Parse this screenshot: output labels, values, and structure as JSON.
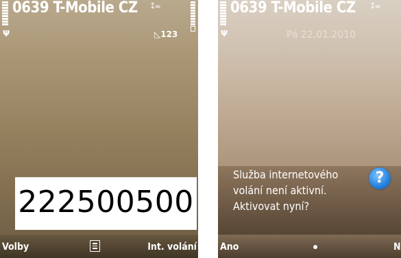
{
  "left_screen": {
    "operator": "0639 T-Mobile CZ",
    "bt_symbol": "⁑≈",
    "antenna_symbol": "Ψ",
    "message_indicator": "◺123",
    "dialed_number": "222500500",
    "soft_left": "Volby",
    "soft_right": "Int. volání"
  },
  "right_screen": {
    "operator": "0639 T-Mobile CZ",
    "bt_symbol": "⁑≈",
    "antenna_symbol": "Ψ",
    "date": "Pá 22.01.2010",
    "dialog": {
      "line1": "Služba internetového",
      "line2": "volání není aktivní.",
      "line3": "Aktivovat nyní?",
      "icon_glyph": "?"
    },
    "soft_left": "Ano",
    "soft_right": "N"
  },
  "colors": {
    "left_bg": "#96825f",
    "right_bg": "#c2ae98",
    "question_icon": "#2a86e0"
  }
}
